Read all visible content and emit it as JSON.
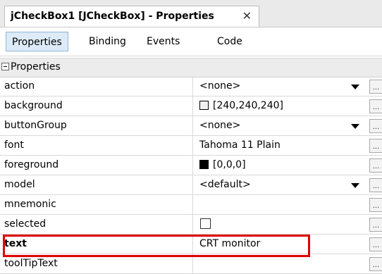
{
  "window": {
    "tab_title": "jCheckBox1 [JCheckBox] - Properties",
    "close_glyph": "✕"
  },
  "subtabs": [
    {
      "label": "Properties",
      "active": true
    },
    {
      "label": "Binding",
      "active": false
    },
    {
      "label": "Events",
      "active": false
    },
    {
      "label": "Code",
      "active": false
    }
  ],
  "section": {
    "label": "Properties"
  },
  "properties": [
    {
      "name": "action",
      "value": "<none>",
      "dropdown": true
    },
    {
      "name": "background",
      "value": "[240,240,240]",
      "swatch": "#f0f0f0"
    },
    {
      "name": "buttonGroup",
      "value": "<none>",
      "dropdown": true
    },
    {
      "name": "font",
      "value": "Tahoma 11 Plain"
    },
    {
      "name": "foreground",
      "value": "[0,0,0]",
      "swatch": "#000000"
    },
    {
      "name": "model",
      "value": "<default>",
      "dropdown": true
    },
    {
      "name": "mnemonic",
      "value": ""
    },
    {
      "name": "selected",
      "value": "",
      "checkbox": false
    },
    {
      "name": "text",
      "value": "CRT monitor",
      "bold": true
    },
    {
      "name": "toolTipText",
      "value": ""
    }
  ],
  "ellipsis_label": "...",
  "colors": {
    "highlight": "#e00000",
    "active_tab": "#dcebf7"
  }
}
